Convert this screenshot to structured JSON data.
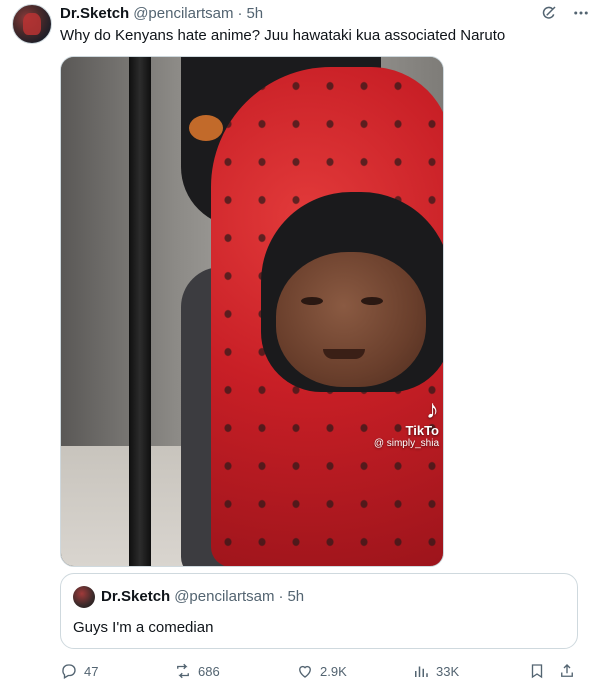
{
  "tweet": {
    "author": {
      "display_name": "Dr.Sketch",
      "handle": "@pencilartsam",
      "separator": "·",
      "time": "5h"
    },
    "text": "Why do Kenyans hate anime? Juu hawataki kua associated Naruto",
    "media": {
      "watermark_brand": "TikTo",
      "watermark_user": "@ simply_shia"
    },
    "quote": {
      "display_name": "Dr.Sketch",
      "handle": "@pencilartsam",
      "separator": "·",
      "time": "5h",
      "text": "Guys I'm a comedian"
    },
    "actions": {
      "replies": "47",
      "reposts": "686",
      "likes": "2.9K",
      "views": "33K"
    }
  },
  "icons": {
    "more": "more-icon",
    "grok": "grok-icon",
    "reply": "reply-icon",
    "repost": "repost-icon",
    "like": "like-icon",
    "views": "views-icon",
    "bookmark": "bookmark-icon",
    "share": "share-icon"
  },
  "colors": {
    "text_primary": "#0f1419",
    "text_secondary": "#536471",
    "border": "#cfd9de"
  }
}
